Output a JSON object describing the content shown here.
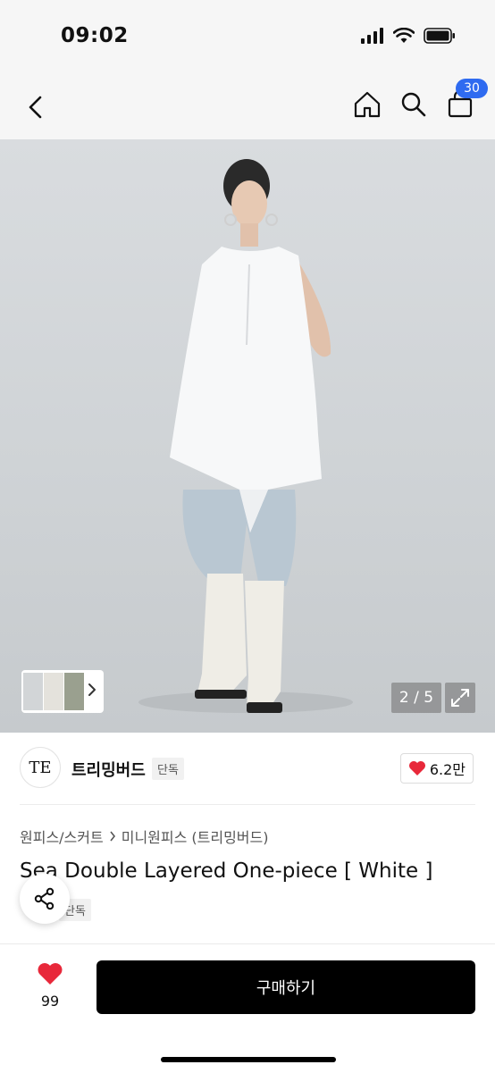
{
  "status_bar": {
    "time": "09:02"
  },
  "nav": {
    "cart_count": "30"
  },
  "gallery": {
    "counter": "2 / 5"
  },
  "brand": {
    "logo_text": "TE",
    "name": "트리밍버드",
    "badge": "단독",
    "likes": "6.2만"
  },
  "product": {
    "breadcrumb": [
      "원피스/스커트",
      "미니원피스 (트리밍버드)"
    ],
    "title": "Sea Double Layered One-piece [ White ]",
    "badge": "단독"
  },
  "bottom": {
    "wish_count": "99",
    "buy_label": "구매하기"
  },
  "colors": {
    "accent": "#2f6bf0",
    "heart": "#e8283a",
    "buy_bg": "#000000"
  }
}
